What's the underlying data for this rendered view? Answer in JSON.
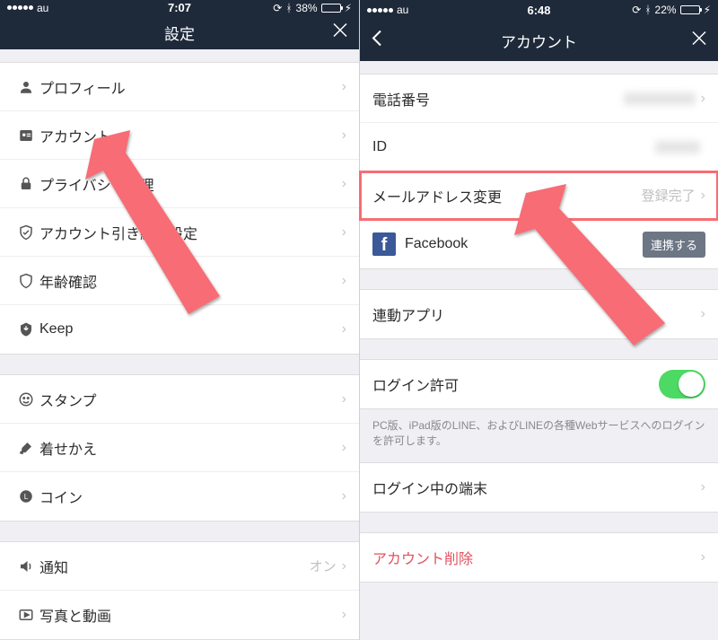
{
  "left": {
    "status": {
      "carrier": "au",
      "time": "7:07",
      "battery_pct": "38%"
    },
    "header": {
      "title": "設定"
    },
    "groups": [
      [
        {
          "label": "プロフィール"
        },
        {
          "label": "アカウント"
        },
        {
          "label": "プライバシー管理"
        },
        {
          "label": "アカウント引き継ぎ設定"
        },
        {
          "label": "年齢確認"
        },
        {
          "label": "Keep"
        }
      ],
      [
        {
          "label": "スタンプ"
        },
        {
          "label": "着せかえ"
        },
        {
          "label": "コイン"
        }
      ],
      [
        {
          "label": "通知",
          "sub": "オン"
        },
        {
          "label": "写真と動画"
        }
      ]
    ]
  },
  "right": {
    "status": {
      "carrier": "au",
      "time": "6:48",
      "battery_pct": "22%"
    },
    "header": {
      "title": "アカウント"
    },
    "rows": {
      "phone": "電話番号",
      "id": "ID",
      "email": "メールアドレス変更",
      "email_sub": "登録完了",
      "facebook": "Facebook",
      "fb_link": "連携する",
      "linked_apps": "連動アプリ",
      "login_allow": "ログイン許可",
      "login_desc": "PC版、iPad版のLINE、およびLINEの各種Webサービスへのログインを許可します。",
      "logged_devices": "ログイン中の端末",
      "delete": "アカウント削除"
    }
  }
}
